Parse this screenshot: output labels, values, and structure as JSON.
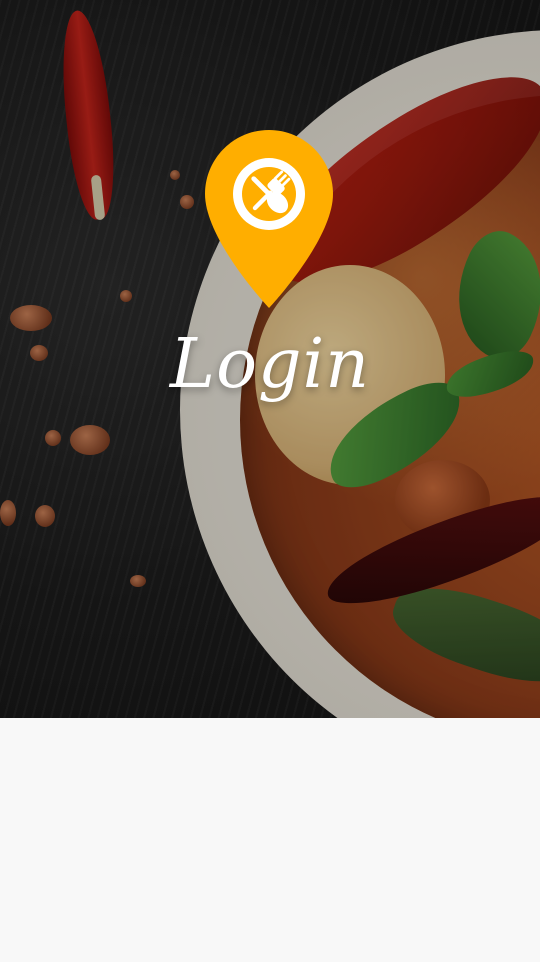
{
  "screen": {
    "title": "Login"
  },
  "logo": {
    "icon": "location-pin-fork-spoon",
    "color": "#FFAE00",
    "inner_color": "#FFFFFF"
  },
  "colors": {
    "background": "#F8F8F8"
  }
}
